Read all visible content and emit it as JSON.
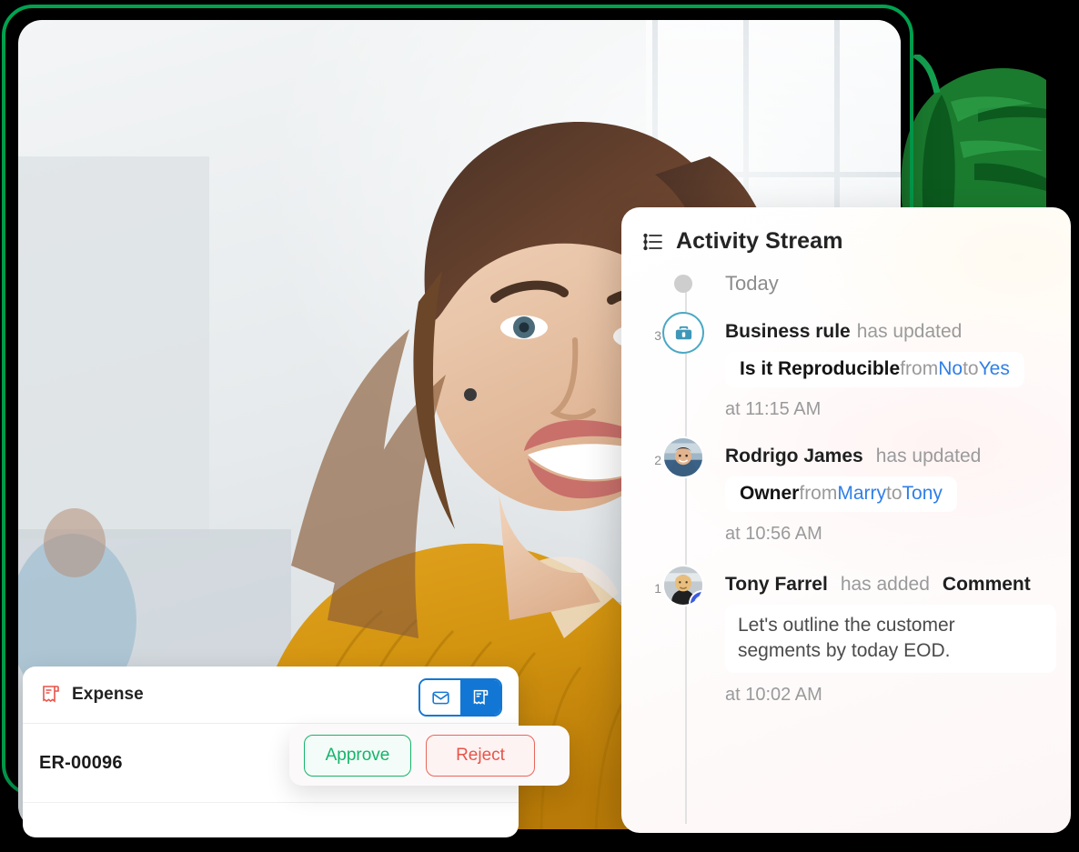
{
  "frame": {
    "accent_color": "#00A551"
  },
  "photo": {
    "alt": "Smiling woman with curly hair wearing a mustard yellow sweater in a bright office"
  },
  "expense_card": {
    "icon": "receipt-icon",
    "title": "Expense",
    "record_id": "ER-00096",
    "toggle": {
      "options": [
        {
          "icon": "envelope-icon",
          "selected": false
        },
        {
          "icon": "receipt-icon",
          "selected": true
        }
      ]
    },
    "actions": {
      "approve_label": "Approve",
      "reject_label": "Reject",
      "approve_color": "#16B36B",
      "reject_color": "#E8544A"
    }
  },
  "activity_stream": {
    "icon": "activity-list-icon",
    "title": "Activity Stream",
    "day_label": "Today",
    "entries": [
      {
        "index": "3",
        "marker": "briefcase-icon",
        "actor": "Business rule",
        "action": "has updated",
        "change": {
          "field": "Is it Reproducible",
          "from_label": "from",
          "from_value": "No",
          "to_label": "to",
          "to_value": "Yes"
        },
        "time": "at 11:15 AM"
      },
      {
        "index": "2",
        "marker": "avatar",
        "actor": "Rodrigo James",
        "action": "has updated",
        "change": {
          "field": "Owner",
          "from_label": "from",
          "from_value": "Marry",
          "to_label": "to",
          "to_value": "Tony"
        },
        "time": "at 10:56 AM"
      },
      {
        "index": "1",
        "marker": "avatar-with-comment-badge",
        "actor": "Tony Farrel",
        "action": "has added",
        "object": "Comment",
        "comment": "Let's outline the customer segments by today EOD.",
        "time": "at 10:02 AM"
      }
    ],
    "link_color": "#2F7FE8"
  }
}
